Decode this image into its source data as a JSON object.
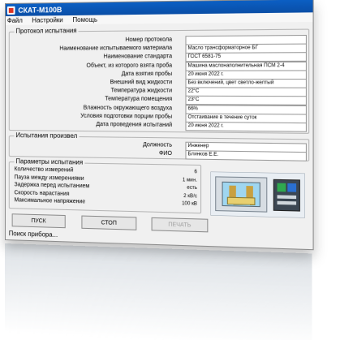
{
  "window": {
    "title": "СКАТ-М100В"
  },
  "menu": {
    "items": [
      "Файл",
      "Настройки",
      "Помощь"
    ]
  },
  "protocol_group": {
    "title": "Протокол испытания",
    "fields": [
      {
        "label": "Номер протокола",
        "value": ""
      },
      {
        "label": "Наименование испытываемого материала",
        "value": "Масло трансформаторное БГ"
      },
      {
        "label": "Наименование стандарта",
        "value": "ГОСТ 6581-75"
      },
      {
        "label": "Объект, из которого взята проба",
        "value": "Машина маслонаполнительная ПСМ 2-4"
      },
      {
        "label": "Дата взятия пробы",
        "value": "20 июня 2022 г."
      },
      {
        "label": "Внешний вид жидкости",
        "value": "Без включений, цвет светло-желтый"
      },
      {
        "label": "Температура жидкости",
        "value": "22°C"
      },
      {
        "label": "Температура помещения",
        "value": "23°C"
      },
      {
        "label": "Влажность окружающего воздуха",
        "value": "66%"
      },
      {
        "label": "Условия подготовки порции пробы",
        "value": "Отстаивание в течение суток"
      },
      {
        "label": "Дата проведения испытаний",
        "value": "20 июня 2022 г."
      }
    ]
  },
  "tests_group": {
    "title": "Испытания произвел",
    "position_label": "Должность",
    "position_value": "Инженер",
    "name_label": "ФИО",
    "name_value": "Блинков Е.Е."
  },
  "params_group": {
    "title": "Параметры испытания",
    "rows": [
      {
        "label": "Количество измерений",
        "value": "6"
      },
      {
        "label": "Пауза между измерениями",
        "value": "1 мин."
      },
      {
        "label": "Задержка перед испытанием",
        "value": "есть"
      },
      {
        "label": "Скорость нарастания",
        "value": "2 кВ/с"
      },
      {
        "label": "Максимальное напряжение",
        "value": "100 кВ"
      }
    ]
  },
  "buttons": {
    "start": "ПУСК",
    "stop": "СТОП",
    "print": "ПЕЧАТЬ"
  },
  "status": {
    "search": "Поиск прибора..."
  },
  "colors": {
    "titlebar": "#0b5fc4",
    "device_green": "#2fa84f",
    "device_blue": "#2a6fd0"
  }
}
